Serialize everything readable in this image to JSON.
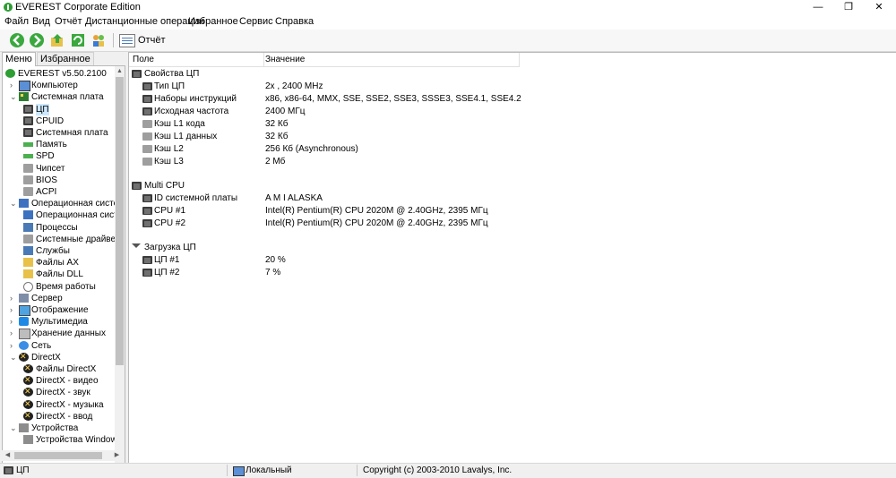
{
  "window": {
    "title": "EVEREST Corporate Edition",
    "minimize": "—",
    "maximize": "❐",
    "close": "✕"
  },
  "menu": [
    "Файл",
    "Вид",
    "Отчёт",
    "Дистанционные операции",
    "Избранное",
    "Сервис",
    "Справка"
  ],
  "toolbar": {
    "report_label": "Отчёт"
  },
  "left_tabs": {
    "menu": "Меню",
    "favorites": "Избранное"
  },
  "tree": [
    {
      "label": "EVEREST v5.50.2100",
      "icon": "everest-icon",
      "level": 0,
      "expander": ""
    },
    {
      "label": "Компьютер",
      "icon": "computer-icon",
      "level": 1,
      "expander": "›"
    },
    {
      "label": "Системная плата",
      "icon": "motherboard-icon",
      "level": 1,
      "expander": "⌄"
    },
    {
      "label": "ЦП",
      "icon": "cpu-icon",
      "level": 2,
      "expander": "",
      "selected": true
    },
    {
      "label": "CPUID",
      "icon": "cpu-icon",
      "level": 2,
      "expander": ""
    },
    {
      "label": "Системная плата",
      "icon": "chip-icon",
      "level": 2,
      "expander": ""
    },
    {
      "label": "Память",
      "icon": "ram-icon",
      "level": 2,
      "expander": ""
    },
    {
      "label": "SPD",
      "icon": "ram-icon",
      "level": 2,
      "expander": ""
    },
    {
      "label": "Чипсет",
      "icon": "chipset-icon",
      "level": 2,
      "expander": ""
    },
    {
      "label": "BIOS",
      "icon": "bios-icon",
      "level": 2,
      "expander": ""
    },
    {
      "label": "ACPI",
      "icon": "acpi-icon",
      "level": 2,
      "expander": ""
    },
    {
      "label": "Операционная система",
      "icon": "os-icon",
      "level": 1,
      "expander": "⌄"
    },
    {
      "label": "Операционная система",
      "icon": "os-icon",
      "level": 2,
      "expander": ""
    },
    {
      "label": "Процессы",
      "icon": "process-icon",
      "level": 2,
      "expander": ""
    },
    {
      "label": "Системные драйверы",
      "icon": "driver-icon",
      "level": 2,
      "expander": ""
    },
    {
      "label": "Службы",
      "icon": "services-icon",
      "level": 2,
      "expander": ""
    },
    {
      "label": "Файлы AX",
      "icon": "file-icon",
      "level": 2,
      "expander": ""
    },
    {
      "label": "Файлы DLL",
      "icon": "file-icon",
      "level": 2,
      "expander": ""
    },
    {
      "label": "Время работы",
      "icon": "clock-icon",
      "level": 2,
      "expander": ""
    },
    {
      "label": "Сервер",
      "icon": "server-icon",
      "level": 1,
      "expander": "›"
    },
    {
      "label": "Отображение",
      "icon": "display-icon",
      "level": 1,
      "expander": "›"
    },
    {
      "label": "Мультимедиа",
      "icon": "multimedia-icon",
      "level": 1,
      "expander": "›"
    },
    {
      "label": "Хранение данных",
      "icon": "storage-icon",
      "level": 1,
      "expander": "›"
    },
    {
      "label": "Сеть",
      "icon": "network-icon",
      "level": 1,
      "expander": "›"
    },
    {
      "label": "DirectX",
      "icon": "directx-icon",
      "level": 1,
      "expander": "⌄"
    },
    {
      "label": "Файлы DirectX",
      "icon": "directx-icon",
      "level": 2,
      "expander": ""
    },
    {
      "label": "DirectX - видео",
      "icon": "directx-icon",
      "level": 2,
      "expander": ""
    },
    {
      "label": "DirectX - звук",
      "icon": "directx-icon",
      "level": 2,
      "expander": ""
    },
    {
      "label": "DirectX - музыка",
      "icon": "directx-icon",
      "level": 2,
      "expander": ""
    },
    {
      "label": "DirectX - ввод",
      "icon": "directx-icon",
      "level": 2,
      "expander": ""
    },
    {
      "label": "Устройства",
      "icon": "devices-icon",
      "level": 1,
      "expander": "⌄"
    },
    {
      "label": "Устройства Windows",
      "icon": "devices-icon",
      "level": 2,
      "expander": ""
    }
  ],
  "columns": {
    "field": "Поле",
    "value": "Значение"
  },
  "sections": [
    {
      "title": "Свойства ЦП",
      "icon": "cpu-icon",
      "rows": [
        {
          "field": "Тип ЦП",
          "value": "2x , 2400 MHz",
          "icon": "cpu-icon"
        },
        {
          "field": "Наборы инструкций",
          "value": "x86, x86-64, MMX, SSE, SSE2, SSE3, SSSE3, SSE4.1, SSE4.2",
          "icon": "cpu-icon"
        },
        {
          "field": "Исходная частота",
          "value": "2400 МГц",
          "icon": "cpu-icon"
        },
        {
          "field": "Кэш L1 кода",
          "value": "32 Кб",
          "icon": "cache-icon"
        },
        {
          "field": "Кэш L1 данных",
          "value": "32 Кб",
          "icon": "cache-icon"
        },
        {
          "field": "Кэш L2",
          "value": "256 Кб  (Asynchronous)",
          "icon": "cache-icon"
        },
        {
          "field": "Кэш L3",
          "value": "2 Мб",
          "icon": "cache-icon"
        }
      ]
    },
    {
      "title": "Multi CPU",
      "icon": "cpu-icon",
      "rows": [
        {
          "field": "ID системной платы",
          "value": "A M I ALASKA",
          "icon": "cpu-icon"
        },
        {
          "field": "CPU #1",
          "value": "Intel(R) Pentium(R) CPU 2020M @ 2.40GHz, 2395 МГц",
          "icon": "cpu-icon"
        },
        {
          "field": "CPU #2",
          "value": "Intel(R) Pentium(R) CPU 2020M @ 2.40GHz, 2395 МГц",
          "icon": "cpu-icon"
        }
      ]
    },
    {
      "title": "Загрузка ЦП",
      "icon": "hourglass-icon",
      "rows": [
        {
          "field": "ЦП #1",
          "value": "20 %",
          "icon": "cpu-icon"
        },
        {
          "field": "ЦП #2",
          "value": "7 %",
          "icon": "cpu-icon"
        }
      ]
    }
  ],
  "status": {
    "left": "ЦП",
    "middle": "Локальный",
    "right": "Copyright (c) 2003-2010 Lavalys, Inc."
  }
}
